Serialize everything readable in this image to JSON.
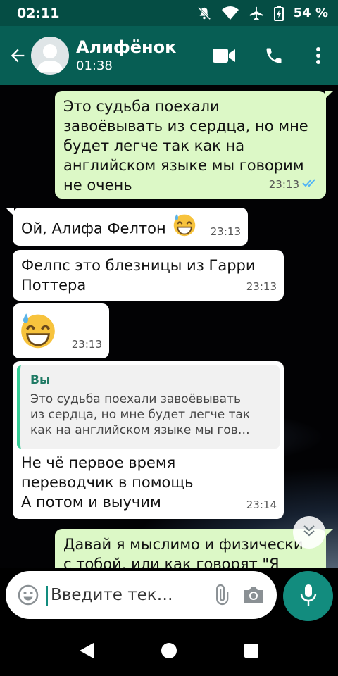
{
  "status_bar": {
    "time": "02:11",
    "battery": "54 %",
    "icons": [
      "mute-icon",
      "wifi-icon",
      "airplane-icon",
      "battery-charging-icon"
    ]
  },
  "header": {
    "contact_name": "Алифёнок",
    "status": "01:38",
    "icons": [
      "back-arrow-icon",
      "avatar-icon",
      "video-call-icon",
      "voice-call-icon",
      "more-options-icon"
    ]
  },
  "messages": [
    {
      "direction": "outgoing",
      "text": "Это судьба поехали\nзавоёвывать из сердца, но мне\nбудет легче так как на\nанглийском языке мы говорим\nне очень",
      "time": "23:13",
      "read_receipt": "double-check-icon"
    },
    {
      "direction": "incoming",
      "text": "Ой, Алифа Фелтон",
      "emoji": "grinning-sweat-emoji",
      "time": "23:13"
    },
    {
      "direction": "incoming",
      "text": "Фелпс это блезницы из Гарри\nПоттера",
      "time": "23:13"
    },
    {
      "direction": "incoming",
      "emoji": "grinning-sweat-emoji",
      "time": "23:13"
    },
    {
      "direction": "incoming",
      "quote": {
        "author": "Вы",
        "text": "Это судьба поехали завоёвывать\nиз сердца, но мне будет легче так\nкак на английском языке мы гов…"
      },
      "text": "Не чё первое время\nпереводчик в помощь\nА потом и выучим",
      "time": "23:14"
    },
    {
      "direction": "outgoing",
      "text": "Давай я мыслимо и физически\nс тобой, или как говорят \"Я"
    }
  ],
  "composer": {
    "placeholder": "Введите тек…",
    "icons": [
      "emoji-icon",
      "attach-icon",
      "camera-icon",
      "mic-icon"
    ]
  },
  "nav_bar": {
    "icons": [
      "back-triangle-icon",
      "home-circle-icon",
      "recents-square-icon"
    ]
  },
  "colors": {
    "header": "#075e54",
    "status_bar": "#054d44",
    "outgoing_bubble": "#dcf8c6",
    "incoming_bubble": "#ffffff",
    "accent": "#128c7e"
  }
}
